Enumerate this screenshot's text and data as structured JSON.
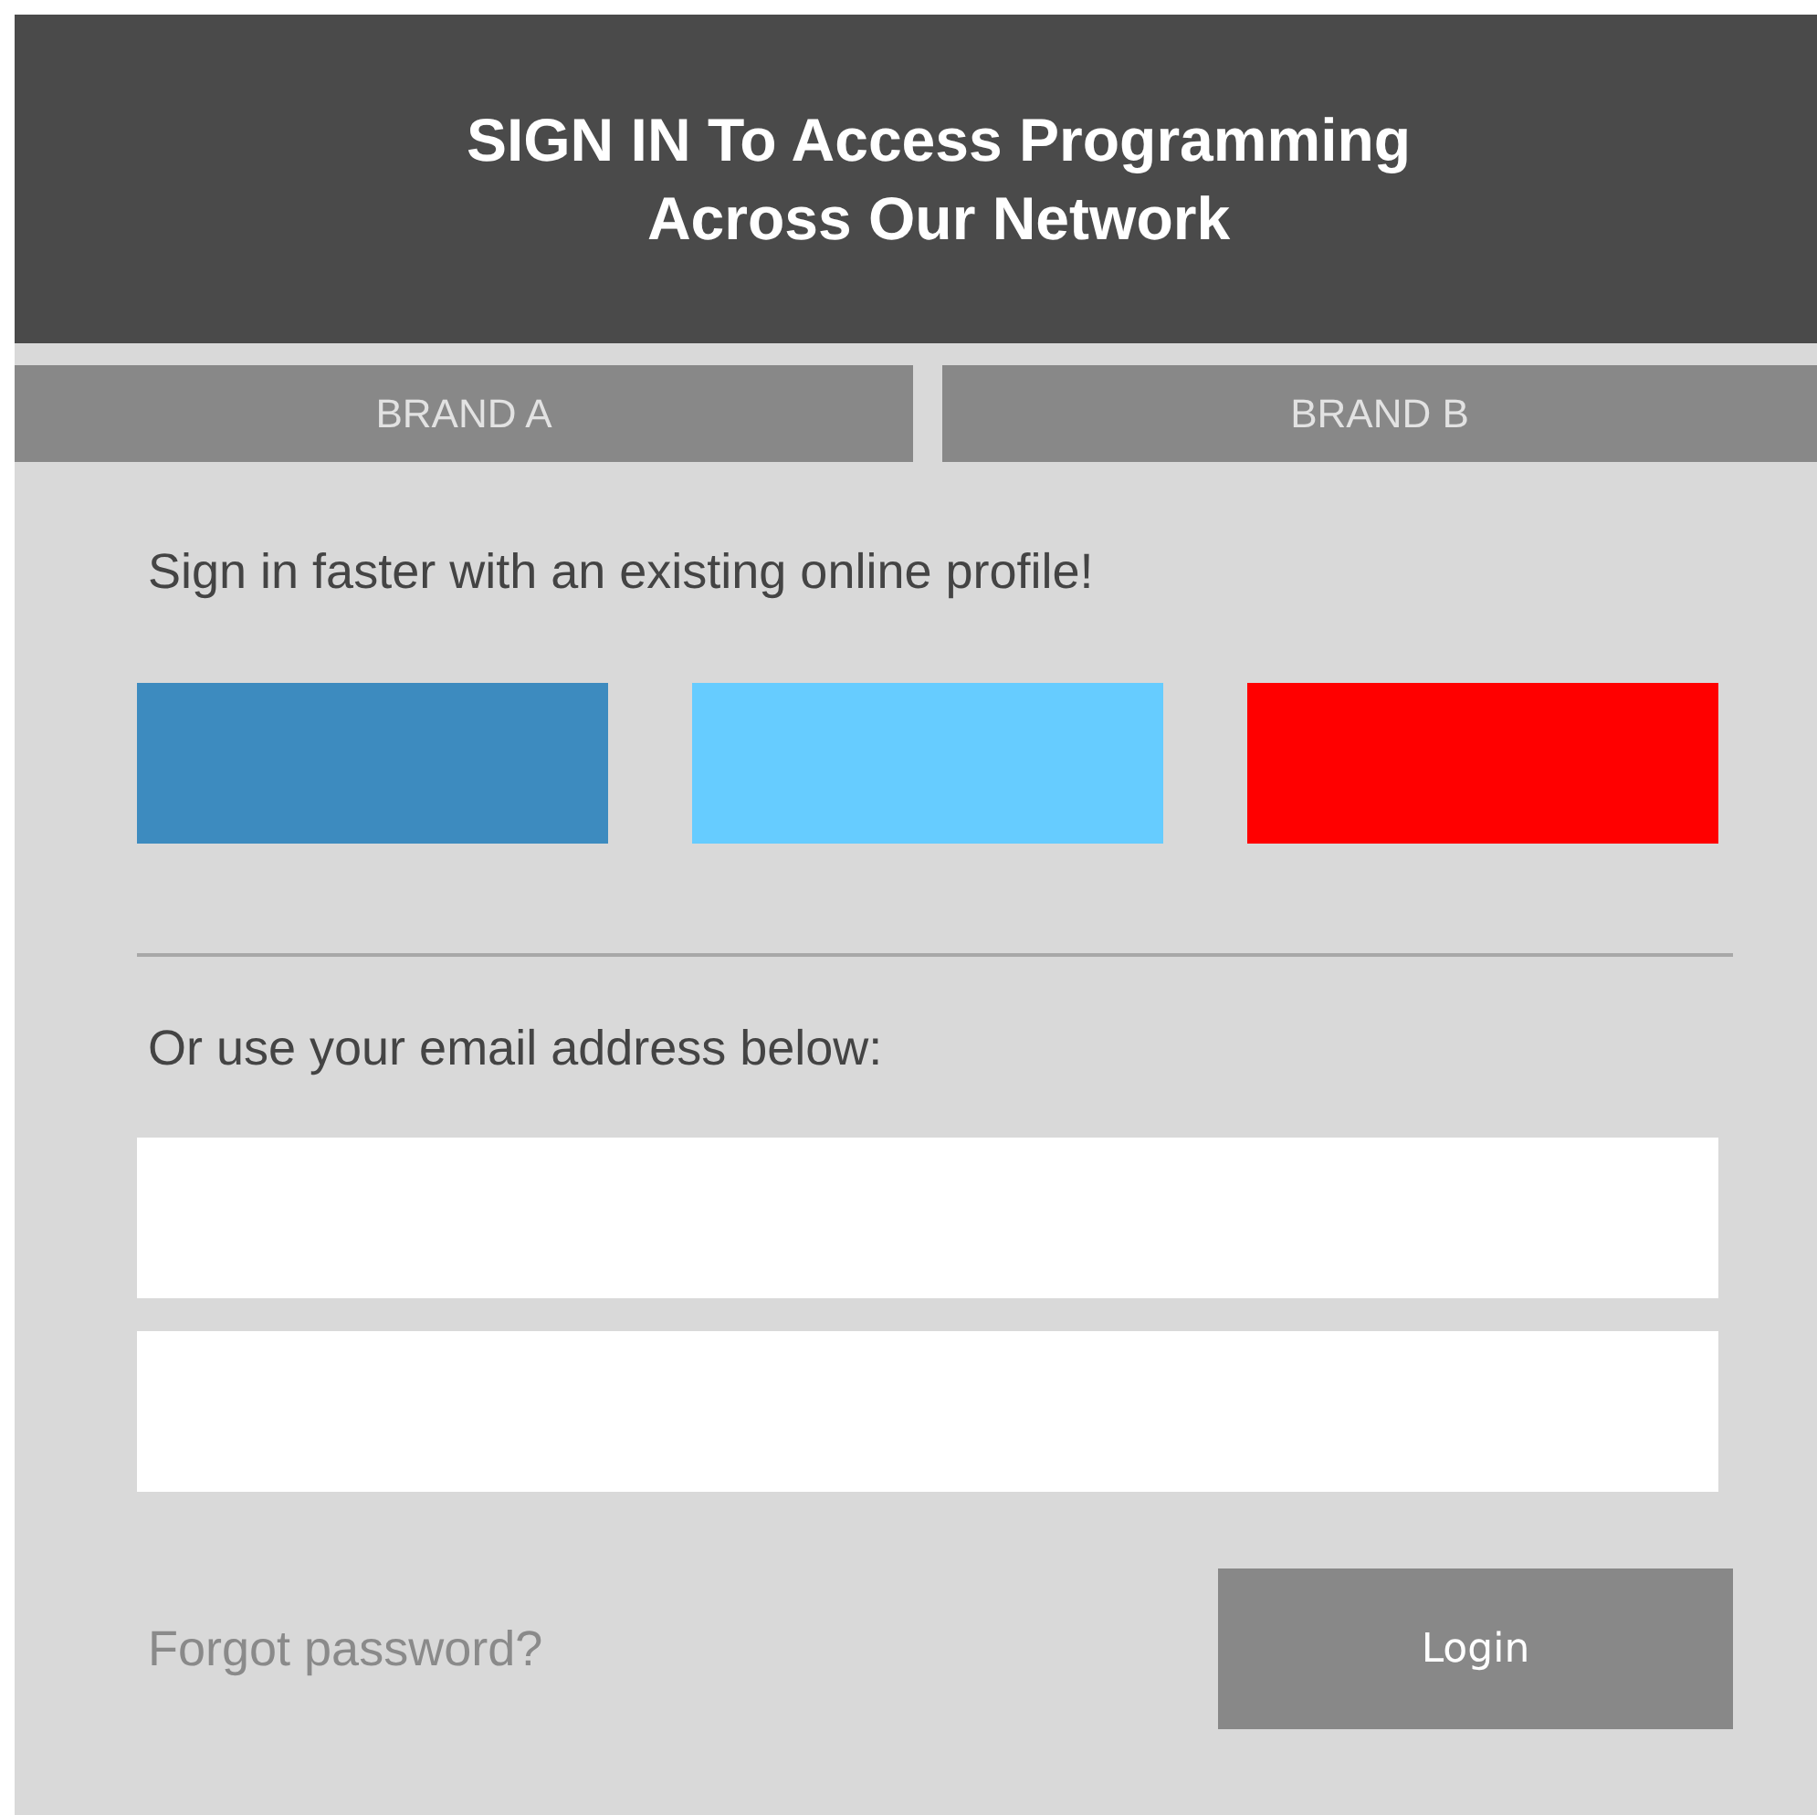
{
  "header": {
    "title_lines": [
      "SIGN IN To Access Programming",
      "Across Our Network"
    ]
  },
  "tabs": [
    {
      "label": "BRAND A"
    },
    {
      "label": "BRAND B"
    }
  ],
  "social_prompt": "Sign in faster with an existing online profile!",
  "social_buttons": [
    {
      "color": "#3d8bbf"
    },
    {
      "color": "#66ccff"
    },
    {
      "color": "#ff0000"
    }
  ],
  "email_prompt": "Or use your email address below:",
  "forgot_link": "Forgot password?",
  "login_button": "Login"
}
